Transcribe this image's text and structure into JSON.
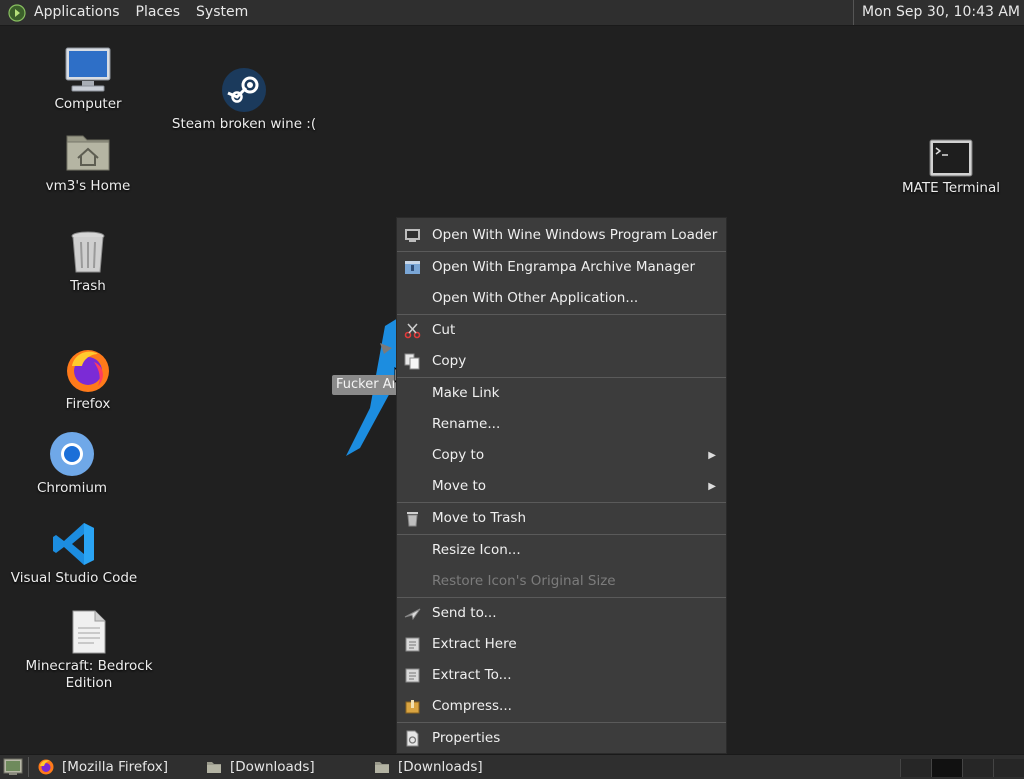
{
  "top_panel": {
    "menus": [
      "Applications",
      "Places",
      "System"
    ],
    "clock": "Mon Sep 30, 10:43 AM"
  },
  "desktop_icons": {
    "computer": "Computer",
    "home": "vm3's Home",
    "trash": "Trash",
    "firefox": "Firefox",
    "chromium": "Chromium",
    "vscode": "Visual Studio Code",
    "minecraft": "Minecraft: Bedrock\nEdition",
    "steam": "Steam broken wine :(",
    "terminal": "MATE Terminal"
  },
  "dragged_icon": {
    "tooltip": "Fucker Angel"
  },
  "context_menu": {
    "items": [
      {
        "label": "Open With Wine Windows Program Loader",
        "icon": "wine-icon"
      },
      {
        "label": "Open With Engrampa Archive Manager",
        "icon": "archive-manager-icon"
      },
      {
        "label": "Open With Other Application...",
        "icon": ""
      },
      {
        "label": "Cut",
        "icon": "scissors-icon"
      },
      {
        "label": "Copy",
        "icon": "copy-icon"
      },
      {
        "label": "Make Link",
        "icon": ""
      },
      {
        "label": "Rename...",
        "icon": ""
      },
      {
        "label": "Copy to",
        "icon": "",
        "submenu": true
      },
      {
        "label": "Move to",
        "icon": "",
        "submenu": true
      },
      {
        "label": "Move to Trash",
        "icon": "trash-icon"
      },
      {
        "label": "Resize Icon...",
        "icon": ""
      },
      {
        "label": "Restore Icon's Original Size",
        "icon": "",
        "disabled": true
      },
      {
        "label": "Send to...",
        "icon": "send-icon"
      },
      {
        "label": "Extract Here",
        "icon": "extract-icon"
      },
      {
        "label": "Extract To...",
        "icon": "extract-icon"
      },
      {
        "label": "Compress...",
        "icon": "compress-icon"
      },
      {
        "label": "Properties",
        "icon": "properties-icon"
      }
    ]
  },
  "taskbar": {
    "tasks": [
      "[Mozilla Firefox]",
      "[Downloads]",
      "[Downloads]"
    ]
  },
  "colors": {
    "desktop_bg": "#202020",
    "panel_bg": "#2f2f2f",
    "menu_bg": "#3c3c3c"
  }
}
